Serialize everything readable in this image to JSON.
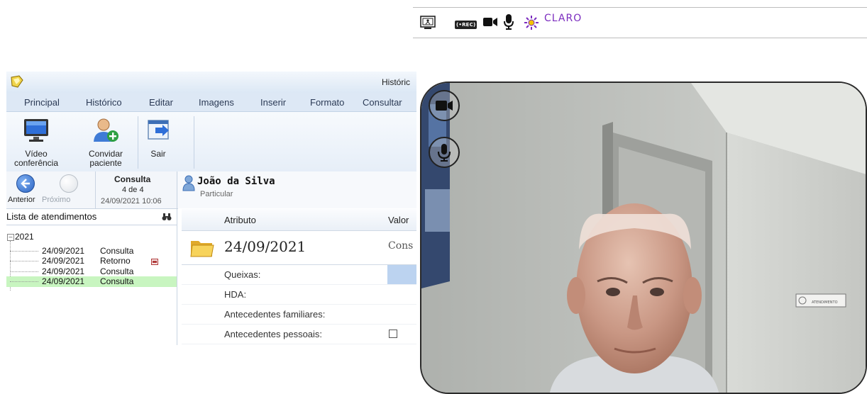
{
  "call_toolbar": {
    "icons": [
      "screen-share-icon",
      "record-icon",
      "camera-icon",
      "microphone-icon",
      "brightness-icon"
    ],
    "record_label": "(•REC)",
    "theme_label": "CLARO",
    "colors": {
      "theme": "#7b2cbf"
    }
  },
  "app": {
    "title": "Históric",
    "menu": [
      "Principal",
      "Histórico",
      "Editar",
      "Imagens",
      "Inserir",
      "Formato",
      "Consultar"
    ],
    "ribbon": {
      "video": {
        "line1": "Vídeo",
        "line2": "conferência"
      },
      "invite": {
        "line1": "Convidar",
        "line2": "paciente"
      },
      "exit": {
        "label": "Sair"
      }
    },
    "nav": {
      "prev": "Anterior",
      "next": "Próximo",
      "kind": "Consulta",
      "position": "4 de 4",
      "datetime": "24/09/2021 10:06"
    },
    "patient": {
      "name": "João da Silva",
      "type": "Particular"
    },
    "list": {
      "title": "Lista de atendimentos",
      "year": "2021",
      "rows": [
        {
          "date": "24/09/2021",
          "type": "Consulta"
        },
        {
          "date": "24/09/2021",
          "type": "Retorno"
        },
        {
          "date": "24/09/2021",
          "type": "Consulta"
        },
        {
          "date": "24/09/2021",
          "type": "Consulta"
        }
      ]
    },
    "attributes": {
      "col_attr": "Atributo",
      "col_value": "Valor",
      "folder_date": "24/09/2021",
      "folder_value": "Cons",
      "rows": [
        "Queixas:",
        "HDA:",
        "Antecedentes familiares:",
        "Antecedentes pessoais:"
      ]
    }
  },
  "video": {
    "controls": [
      "camera-icon",
      "microphone-icon"
    ],
    "sign_text": "ATENDIMENTO"
  }
}
